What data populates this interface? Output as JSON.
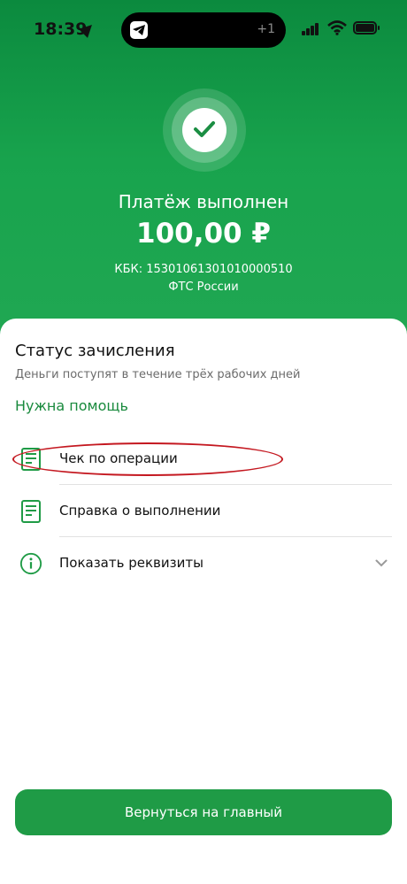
{
  "status_bar": {
    "time": "18:39",
    "island_count": "+1",
    "icons": [
      "location-arrow-icon",
      "telegram-icon",
      "signal-icon",
      "wifi-icon",
      "battery-icon"
    ]
  },
  "hero": {
    "title": "Платёж выполнен",
    "amount": "100,00 ₽",
    "kbk": "КБК: 15301061301010000510",
    "receiver": "ФТС России",
    "icon": "check-icon"
  },
  "sheet": {
    "status_title": "Статус зачисления",
    "status_subtitle": "Деньги поступят в течение трёх рабочих дней",
    "help_link": "Нужна помощь",
    "actions": [
      {
        "label": "Чек по операции",
        "icon": "receipt-icon"
      },
      {
        "label": "Справка о выполнении",
        "icon": "document-icon"
      },
      {
        "label": "Показать реквизиты",
        "icon": "info-icon",
        "expandable": true
      }
    ],
    "home_button": "Вернуться на главный"
  },
  "colors": {
    "brand_green": "#21a853",
    "link_green": "#198a3d",
    "annotation_red": "#c41820"
  }
}
